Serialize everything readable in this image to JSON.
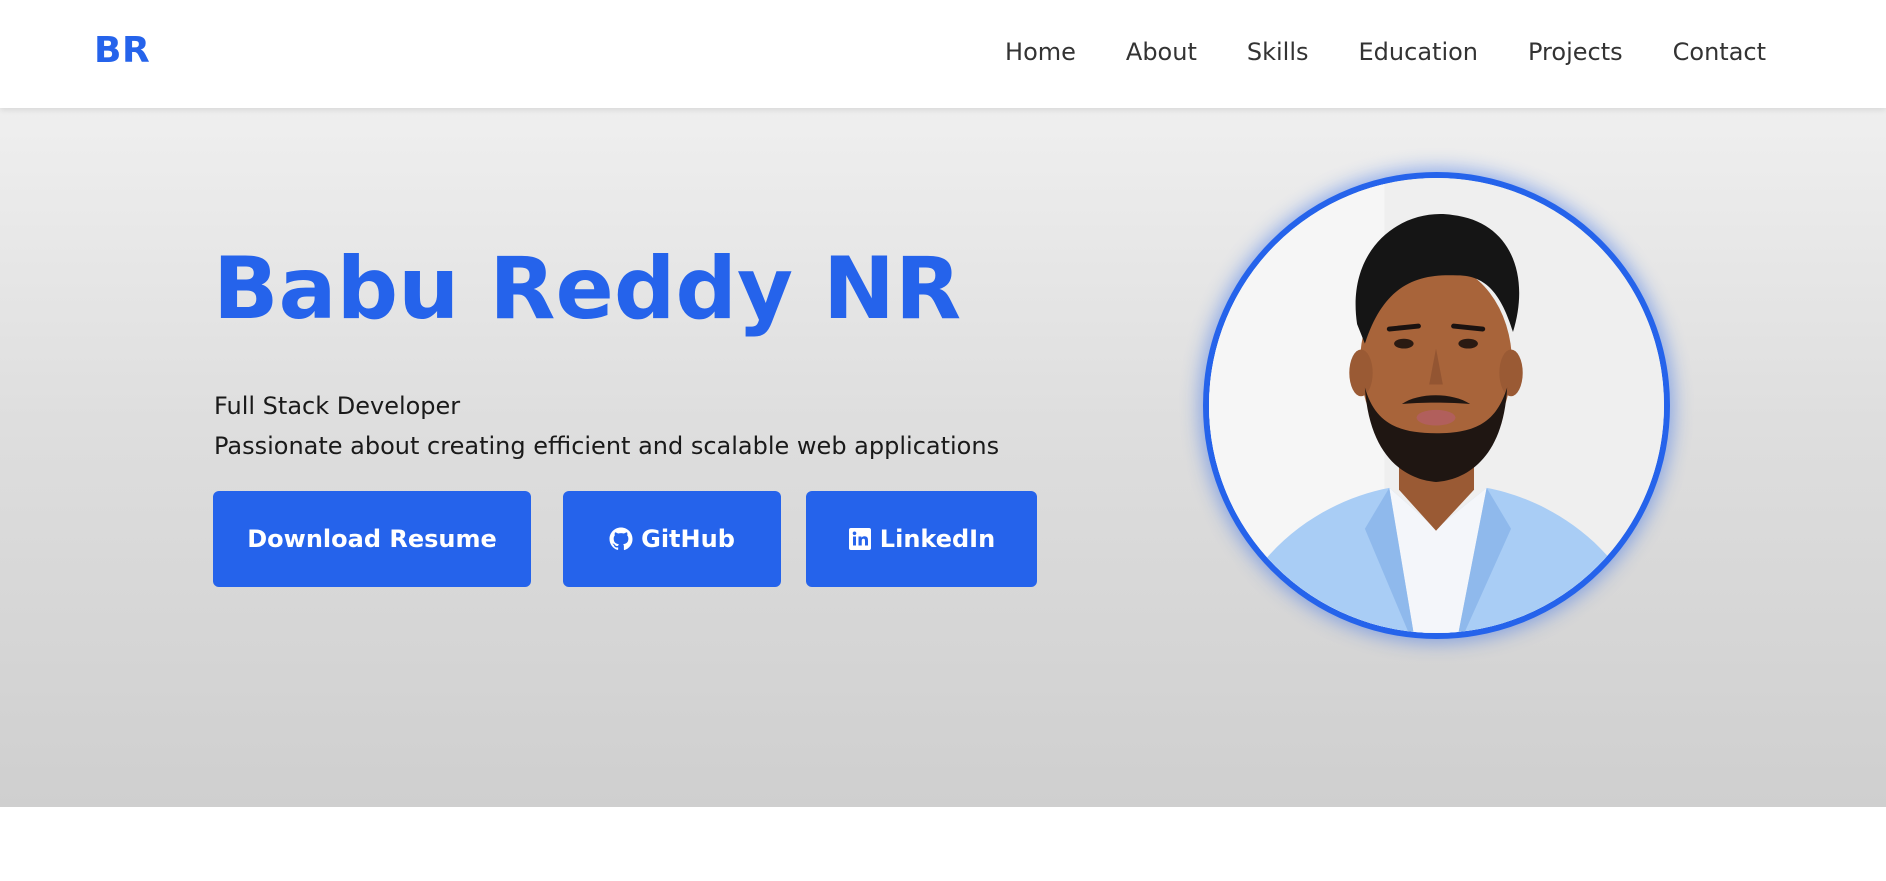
{
  "nav": {
    "logo": "BR",
    "links": [
      "Home",
      "About",
      "Skills",
      "Education",
      "Projects",
      "Contact"
    ]
  },
  "hero": {
    "name": "Babu Reddy NR",
    "role": "Full Stack Developer",
    "tagline": "Passionate about creating efficient and scalable web applications",
    "buttons": {
      "resume": "Download Resume",
      "github": "GitHub",
      "linkedin": "LinkedIn"
    }
  },
  "colors": {
    "accent": "#2563eb",
    "text": "#1a1a1a",
    "nav_text": "#333333"
  },
  "icons": {
    "github": "github-icon",
    "linkedin": "linkedin-icon"
  }
}
